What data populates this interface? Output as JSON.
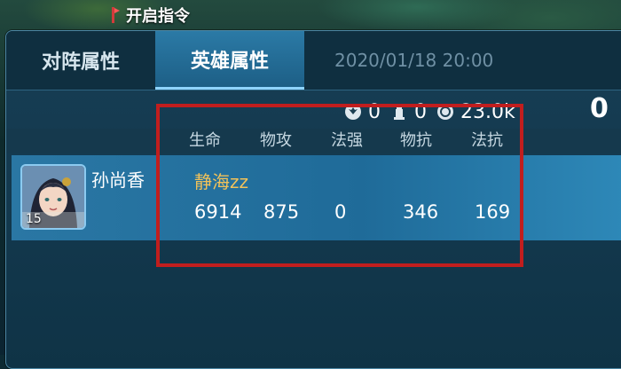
{
  "top_command": {
    "label": "开启指令",
    "icon": "flag-icon"
  },
  "tabs": [
    {
      "label": "对阵属性",
      "active": false
    },
    {
      "label": "英雄属性",
      "active": true
    }
  ],
  "timestamp": "2020/01/18  20:00",
  "stats": [
    {
      "icon": "dragon-icon",
      "value": "0"
    },
    {
      "icon": "tower-icon",
      "value": "0"
    },
    {
      "icon": "gold-coin-icon",
      "value": "23.0k"
    }
  ],
  "score_right": "0",
  "columns": [
    "生命",
    "物攻",
    "法强",
    "物抗",
    "法抗"
  ],
  "hero": {
    "name": "孙尚香",
    "level": "15",
    "player": "静海zz",
    "values": [
      "6914",
      "875",
      "0",
      "346",
      "169"
    ]
  },
  "colors": {
    "highlight": "#c11e1e",
    "player_name": "#f1c25a",
    "active_tab": "#2b7aa6"
  }
}
